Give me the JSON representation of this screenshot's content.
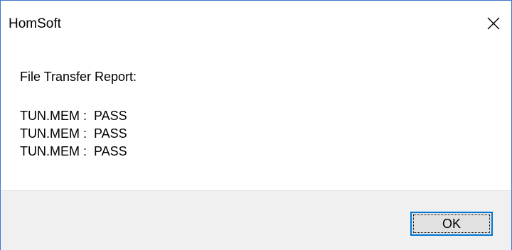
{
  "window": {
    "title": "HomSoft",
    "close_icon": "close-icon"
  },
  "message": {
    "heading": "File Transfer Report:",
    "lines": [
      "TUN.MEM :  PASS",
      "TUN.MEM :  PASS",
      "TUN.MEM :  PASS"
    ]
  },
  "buttons": {
    "ok_label": "OK"
  },
  "colors": {
    "window_border": "#3b77c8",
    "footer_background": "#f0f0f0",
    "button_focus_border": "#0078d7",
    "button_background": "#e1e1e1"
  }
}
